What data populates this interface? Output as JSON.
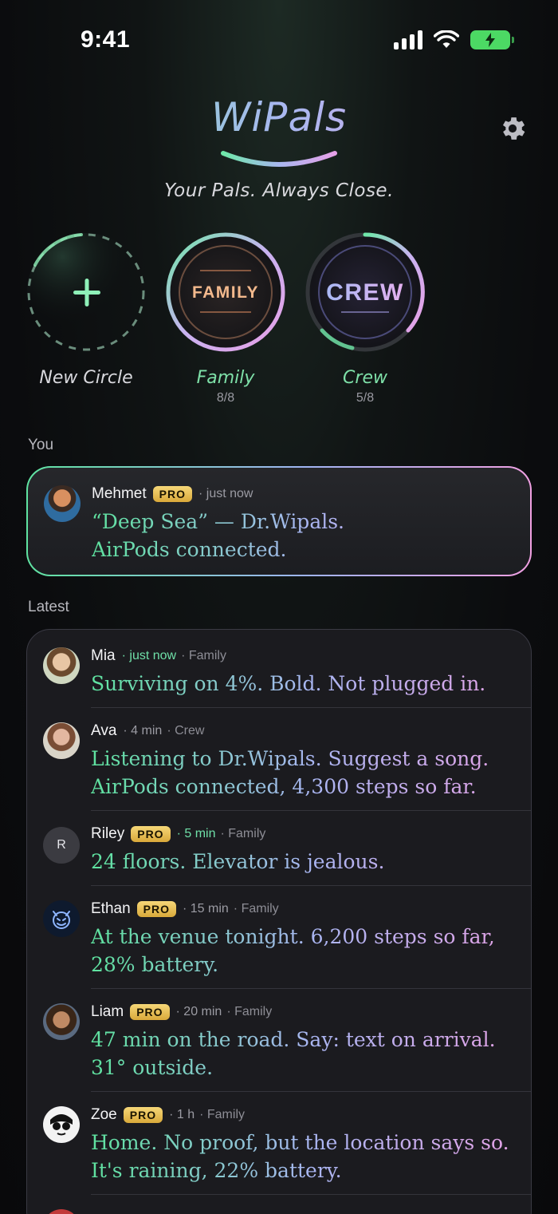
{
  "status": {
    "time": "9:41"
  },
  "brand": {
    "title": "WiPals",
    "tagline": "Your Pals. Always Close."
  },
  "circles": [
    {
      "label": "New Circle",
      "count": ""
    },
    {
      "label": "Family",
      "badge": "FAMILY",
      "count": "8/8"
    },
    {
      "label": "Crew",
      "badge": "CREW",
      "count": "5/8"
    }
  ],
  "sections": {
    "you": "You",
    "latest": "Latest"
  },
  "you": {
    "name": "Mehmet",
    "pro": "PRO",
    "time": "· just now",
    "message": "“Deep Sea” — Dr.Wipals.\nAirPods connected."
  },
  "feed": [
    {
      "name": "Mia",
      "pro": "",
      "time": "· just now",
      "time_green": true,
      "group": "· Family",
      "message": "Surviving on 4%. Bold. Not plugged in."
    },
    {
      "name": "Ava",
      "pro": "",
      "time": "· 4 min",
      "time_green": false,
      "group": "· Crew",
      "message": "Listening to Dr.Wipals. Suggest a song.\nAirPods connected, 4,300 steps so far."
    },
    {
      "name": "Riley",
      "pro": "PRO",
      "time": "· 5 min",
      "time_green": true,
      "group": "· Family",
      "message": "24 floors. Elevator is jealous.",
      "initial": "R"
    },
    {
      "name": "Ethan",
      "pro": "PRO",
      "time": "· 15 min",
      "time_green": false,
      "group": "· Family",
      "message": "At the venue tonight. 6,200 steps so far,\n28% battery."
    },
    {
      "name": "Liam",
      "pro": "PRO",
      "time": "· 20 min",
      "time_green": false,
      "group": "· Family",
      "message": "47 min on the road. Say: text on arrival.\n31° outside."
    },
    {
      "name": "Zoe",
      "pro": "PRO",
      "time": "· 1 h",
      "time_green": false,
      "group": "· Family",
      "message": "Home. No proof, but the location says so.\nIt's raining, 22% battery."
    }
  ],
  "colors": {
    "accent_green": "#5ee39f",
    "accent_blue": "#a9b6f2",
    "accent_pink": "#e9a1e6",
    "pro_gold": "#e9c05a"
  }
}
